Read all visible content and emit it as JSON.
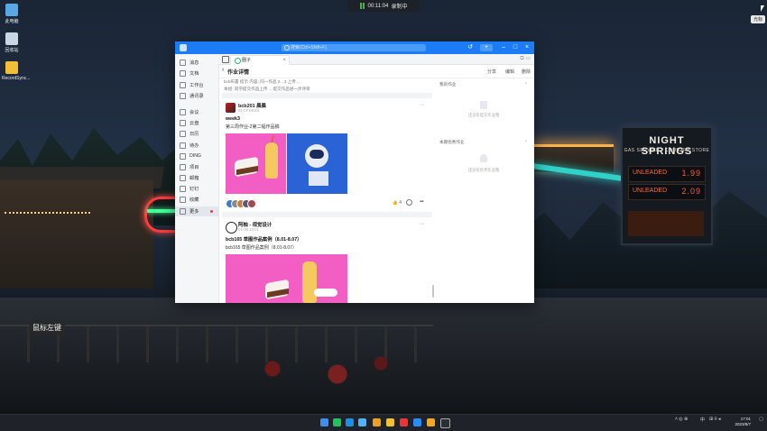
{
  "desktop": {
    "icons": [
      {
        "label": "此电脑",
        "color": "#5aa7e8"
      },
      {
        "label": "回收站",
        "color": "#c9d6e6"
      },
      {
        "label": "RecordSync...",
        "color": "#f2c037"
      }
    ],
    "mouse_tip": "鼠标左键",
    "corner_label": "光标"
  },
  "recorder": {
    "time": "00:11:04",
    "status": "录制中"
  },
  "app": {
    "search_placeholder": "搜索(Ctrl+Shift+F)",
    "sidebar": [
      {
        "label": "消息",
        "icon": "message-icon"
      },
      {
        "label": "文档",
        "icon": "doc-icon"
      },
      {
        "label": "工作台",
        "icon": "workbench-icon"
      },
      {
        "label": "通讯录",
        "icon": "contacts-icon"
      },
      {
        "label": "会议",
        "icon": "meeting-icon"
      },
      {
        "label": "云盘",
        "icon": "cloud-icon"
      },
      {
        "label": "日历",
        "icon": "calendar-icon"
      },
      {
        "label": "待办",
        "icon": "todo-icon"
      },
      {
        "label": "DING",
        "icon": "ding-icon"
      },
      {
        "label": "项目",
        "icon": "project-icon"
      },
      {
        "label": "邮箱",
        "icon": "mail-icon"
      },
      {
        "label": "钉钉",
        "icon": "dingtalk-icon"
      },
      {
        "label": "收藏",
        "icon": "favorite-icon"
      },
      {
        "label": "更多",
        "icon": "more-icon",
        "active": true
      }
    ],
    "tab": {
      "label": "圈子"
    },
    "page": {
      "title": "作业详情",
      "actions": [
        "分享",
        "编辑",
        "删除"
      ]
    },
    "feed_note_lines": [
      "bcb布置 提示 内容: 同一作品 2…3 上传…",
      "本组: 同学提交作品上传 …提交作品进一步评审"
    ],
    "posts": [
      {
        "user": "bcb201 晨晨",
        "date": "01-07 08:53",
        "title": "week3",
        "text": "第三周作业-2第二幅作品稿",
        "likes": "4"
      },
      {
        "user": "阿柚 - 视觉设计",
        "date": "01-06 23:01",
        "title": "bcb165 草图作品案例（8.01-8.07）",
        "text": "bcb165 草图作品案例（8.01-8.07）"
      }
    ],
    "right_panel": [
      {
        "title": "我的作业",
        "empty": "还没有提交作业哦"
      },
      {
        "title": "本期优秀作业",
        "empty": "还没有优秀作业哦"
      }
    ]
  },
  "taskbar": {
    "ime": "中",
    "time": "17:01",
    "date": "2023/8/7"
  }
}
